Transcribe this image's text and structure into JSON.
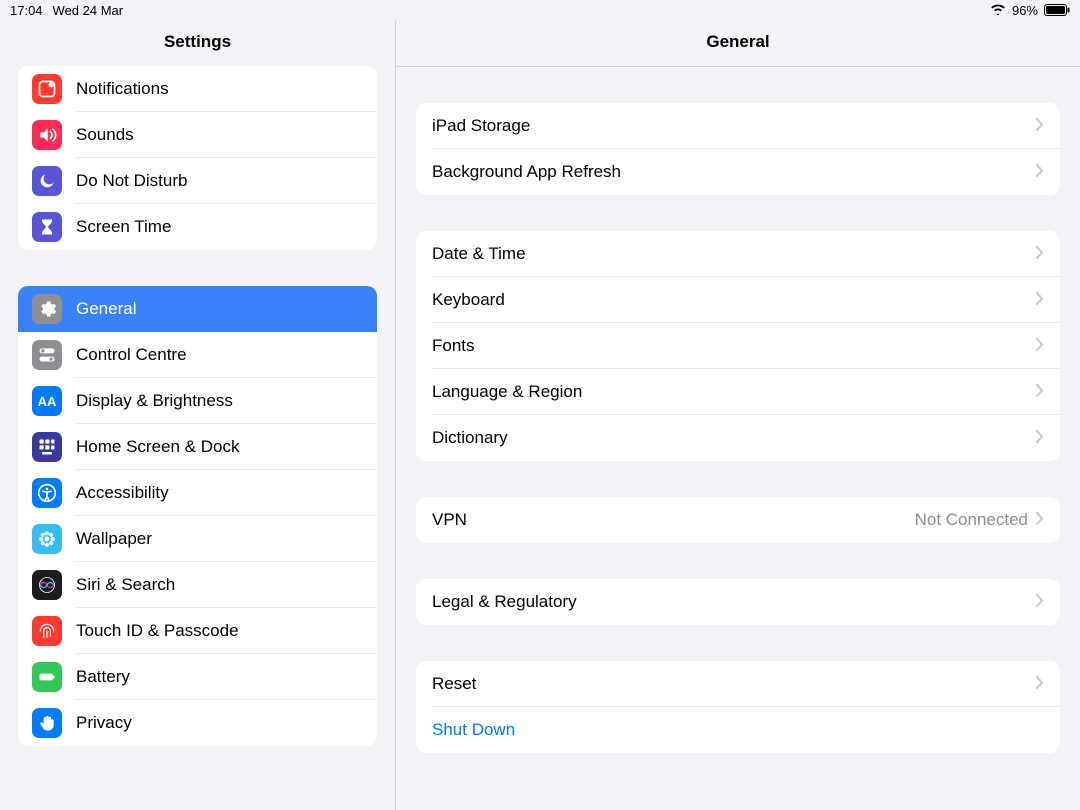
{
  "status": {
    "time": "17:04",
    "date": "Wed 24 Mar",
    "battery": "96%"
  },
  "sidebar": {
    "title": "Settings",
    "groups": [
      {
        "items": [
          {
            "id": "notifications",
            "label": "Notifications",
            "icon": "notifications-icon",
            "bg": "#ff3b30"
          },
          {
            "id": "sounds",
            "label": "Sounds",
            "icon": "sounds-icon",
            "bg": "#ff2d55"
          },
          {
            "id": "dnd",
            "label": "Do Not Disturb",
            "icon": "moon-icon",
            "bg": "#5856d6"
          },
          {
            "id": "screentime",
            "label": "Screen Time",
            "icon": "hourglass-icon",
            "bg": "#5856d6"
          }
        ]
      },
      {
        "items": [
          {
            "id": "general",
            "label": "General",
            "icon": "gear-icon",
            "bg": "#8e8e93",
            "selected": true
          },
          {
            "id": "controlcentre",
            "label": "Control Centre",
            "icon": "toggles-icon",
            "bg": "#8e8e93"
          },
          {
            "id": "display",
            "label": "Display & Brightness",
            "icon": "aa-icon",
            "bg": "#007aff"
          },
          {
            "id": "homescreen",
            "label": "Home Screen & Dock",
            "icon": "grid-icon",
            "bg": "#3a39a0"
          },
          {
            "id": "accessibility",
            "label": "Accessibility",
            "icon": "accessibility-icon",
            "bg": "#007aff"
          },
          {
            "id": "wallpaper",
            "label": "Wallpaper",
            "icon": "flower-icon",
            "bg": "#37bcee"
          },
          {
            "id": "siri",
            "label": "Siri & Search",
            "icon": "siri-icon",
            "bg": "#1c1c1e"
          },
          {
            "id": "touchid",
            "label": "Touch ID & Passcode",
            "icon": "fingerprint-icon",
            "bg": "#ff3b30"
          },
          {
            "id": "battery",
            "label": "Battery",
            "icon": "battery-icon",
            "bg": "#34c759"
          },
          {
            "id": "privacy",
            "label": "Privacy",
            "icon": "hand-icon",
            "bg": "#007aff"
          }
        ]
      }
    ]
  },
  "content": {
    "title": "General",
    "groups": [
      [
        {
          "id": "ipadstorage",
          "label": "iPad Storage"
        },
        {
          "id": "bgrefresh",
          "label": "Background App Refresh"
        }
      ],
      [
        {
          "id": "datetime",
          "label": "Date & Time"
        },
        {
          "id": "keyboard",
          "label": "Keyboard"
        },
        {
          "id": "fonts",
          "label": "Fonts"
        },
        {
          "id": "language",
          "label": "Language & Region"
        },
        {
          "id": "dictionary",
          "label": "Dictionary"
        }
      ],
      [
        {
          "id": "vpn",
          "label": "VPN",
          "value": "Not Connected"
        }
      ],
      [
        {
          "id": "legal",
          "label": "Legal & Regulatory"
        }
      ],
      [
        {
          "id": "reset",
          "label": "Reset"
        },
        {
          "id": "shutdown",
          "label": "Shut Down",
          "link": true,
          "nochevron": true
        }
      ]
    ]
  }
}
